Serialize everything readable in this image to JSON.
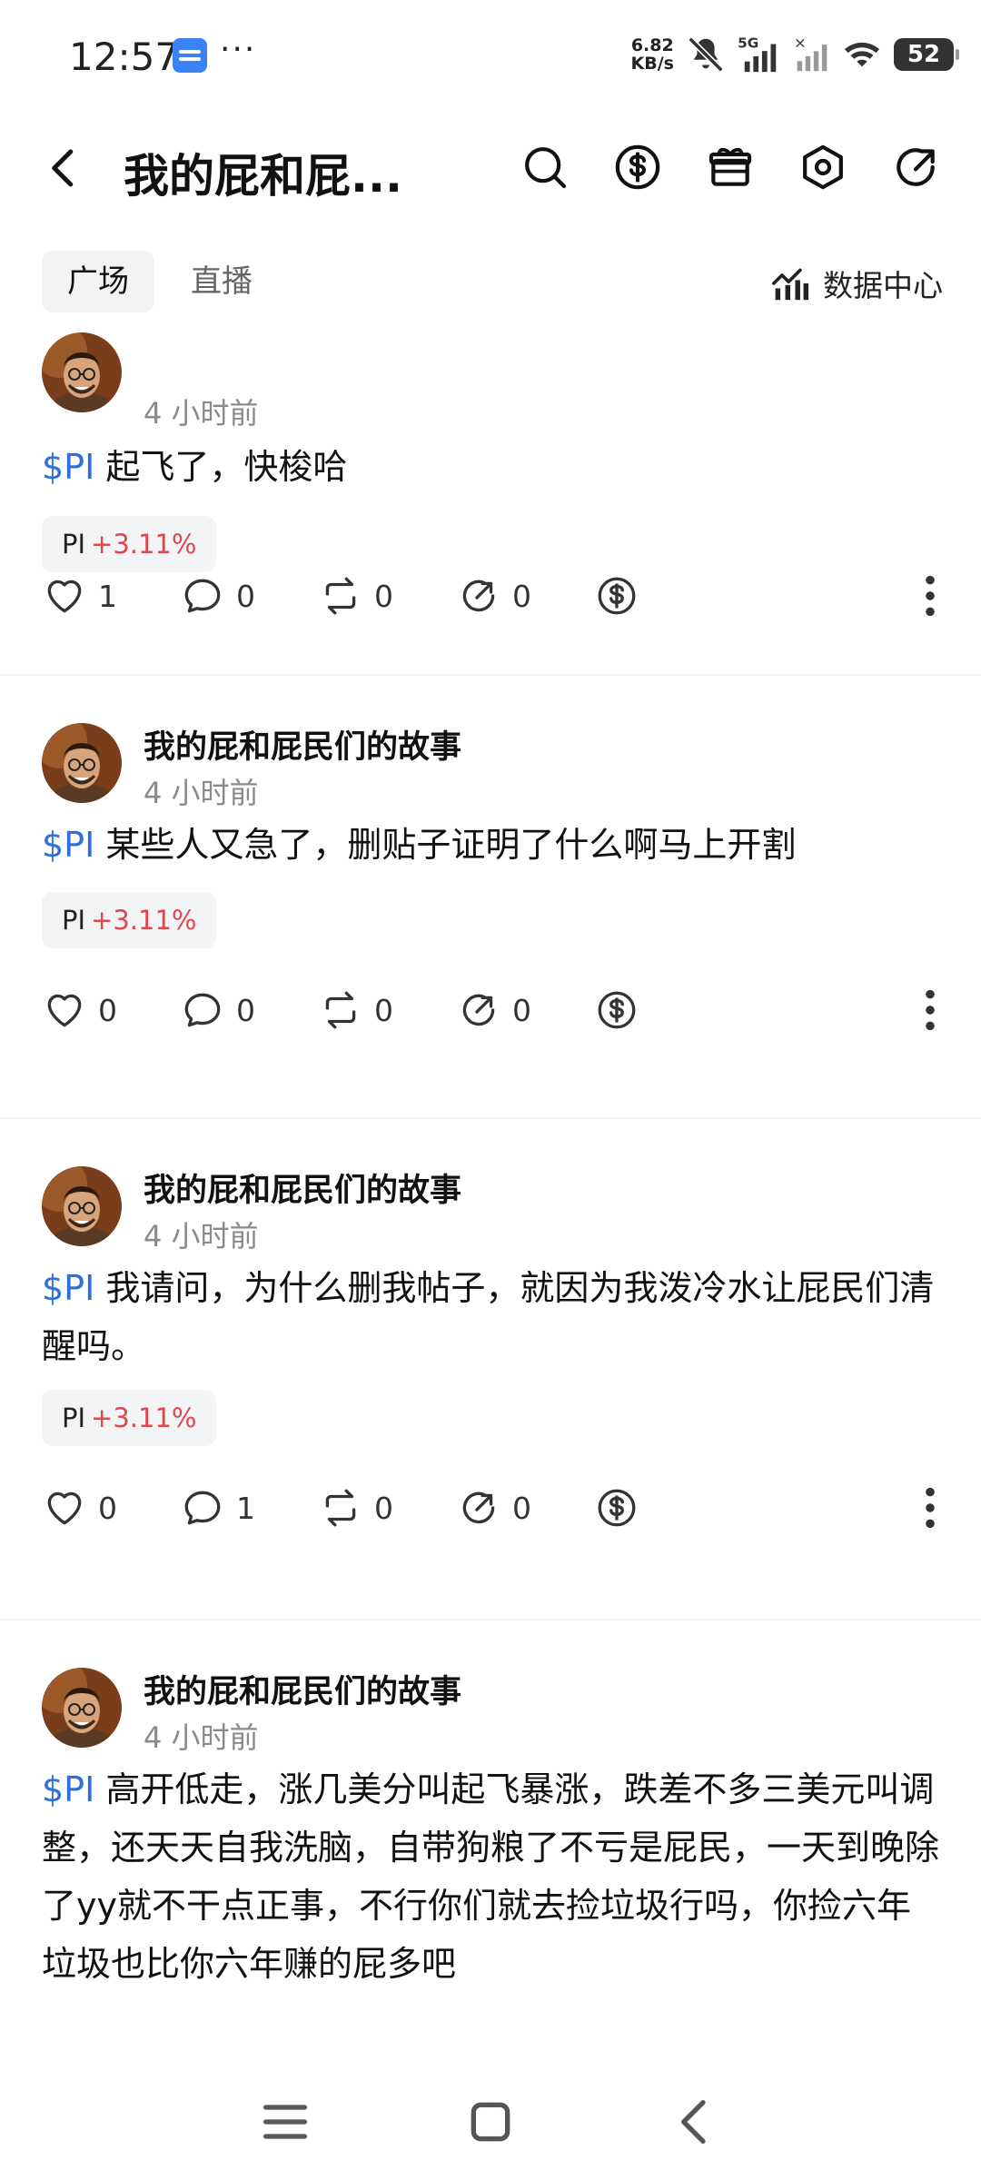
{
  "status_bar": {
    "time": "12:57",
    "more": "···",
    "net_speed_value": "6.82",
    "net_speed_unit": "KB/s",
    "network": "5G",
    "battery": "52"
  },
  "header": {
    "title": "我的屁和屁..."
  },
  "tabs": [
    {
      "label": "广场",
      "active": true
    },
    {
      "label": "直播",
      "active": false
    }
  ],
  "data_center_label": "数据中心",
  "posts": [
    {
      "author": "",
      "time": "4 小时前",
      "ticker": "$PI",
      "text": "起飞了，快梭哈",
      "tag_symbol": "PI",
      "tag_change": "+3.11%",
      "likes": "1",
      "comments": "0",
      "reposts": "0",
      "shares": "0"
    },
    {
      "author": "我的屁和屁民们的故事",
      "time": "4 小时前",
      "ticker": "$PI",
      "text": "某些人又急了，删贴子证明了什么啊马上开割",
      "tag_symbol": "PI",
      "tag_change": "+3.11%",
      "likes": "0",
      "comments": "0",
      "reposts": "0",
      "shares": "0"
    },
    {
      "author": "我的屁和屁民们的故事",
      "time": "4 小时前",
      "ticker": "$PI",
      "text": "我请问，为什么删我帖子，就因为我泼冷水让屁民们清醒吗。",
      "tag_symbol": "PI",
      "tag_change": "+3.11%",
      "likes": "0",
      "comments": "1",
      "reposts": "0",
      "shares": "0"
    },
    {
      "author": "我的屁和屁民们的故事",
      "time": "4 小时前",
      "ticker": "$PI",
      "text": "高开低走，涨几美分叫起飞暴涨，跌差不多三美元叫调整，还天天自我洗脑，自带狗粮了不亏是屁民，一天到晚除了yy就不干点正事，不行你们就去捡垃圾行吗，你捡六年垃圾也比你六年赚的屁多吧"
    }
  ],
  "colors": {
    "ticker": "#2f6fd8",
    "gain": "#e0474c",
    "muted": "#8a8a8a"
  }
}
